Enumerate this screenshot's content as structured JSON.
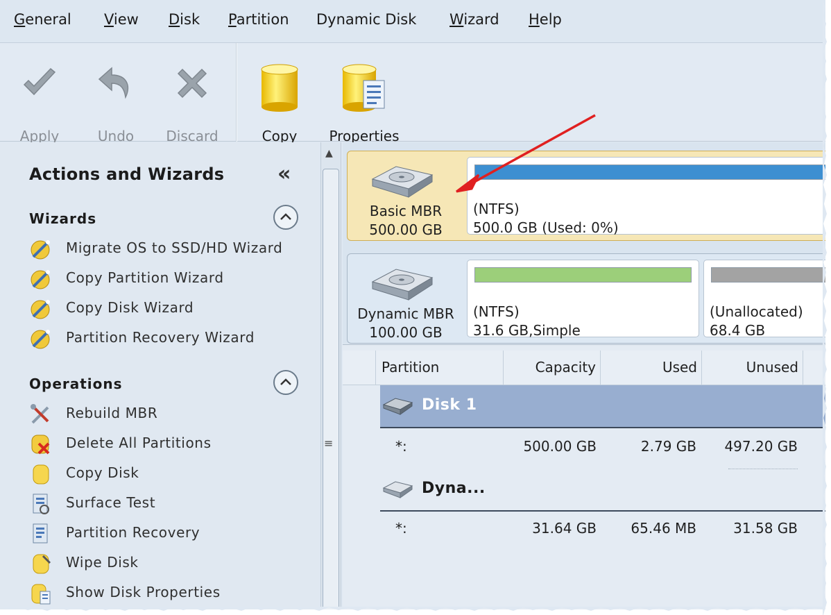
{
  "menubar": {
    "items": [
      {
        "label": "General",
        "underline": "G",
        "rest": "eneral"
      },
      {
        "label": "View",
        "underline": "V",
        "rest": "iew"
      },
      {
        "label": "Disk",
        "underline": "D",
        "rest": "isk"
      },
      {
        "label": "Partition",
        "underline": "P",
        "rest": "artition"
      },
      {
        "label": "Dynamic Disk",
        "underline": "",
        "rest": "Dynamic Disk"
      },
      {
        "label": "Wizard",
        "underline": "W",
        "rest": "izard"
      },
      {
        "label": "Help",
        "underline": "H",
        "rest": "elp"
      }
    ]
  },
  "toolbar": {
    "apply_label": "Apply",
    "undo_label": "Undo",
    "discard_label": "Discard",
    "copy_label": "Copy",
    "properties_label": "Properties"
  },
  "sidebar": {
    "title": "Actions and Wizards",
    "collapse_glyph": "«",
    "wizards": {
      "heading": "Wizards",
      "items": [
        {
          "label": "Migrate OS to SSD/HD Wizard",
          "icon": "wizard-wand-icon"
        },
        {
          "label": "Copy Partition Wizard",
          "icon": "wizard-wand-icon"
        },
        {
          "label": "Copy Disk Wizard",
          "icon": "wizard-wand-icon"
        },
        {
          "label": "Partition Recovery Wizard",
          "icon": "wizard-wand-icon"
        }
      ]
    },
    "operations": {
      "heading": "Operations",
      "items": [
        {
          "label": "Rebuild MBR",
          "icon": "tools-icon"
        },
        {
          "label": "Delete All Partitions",
          "icon": "delete-disk-icon"
        },
        {
          "label": "Copy Disk",
          "icon": "disk-copy-icon"
        },
        {
          "label": "Surface Test",
          "icon": "surface-test-icon"
        },
        {
          "label": "Partition Recovery",
          "icon": "partition-recovery-icon"
        },
        {
          "label": "Wipe Disk",
          "icon": "wipe-disk-icon"
        },
        {
          "label": "Show Disk Properties",
          "icon": "disk-properties-icon"
        }
      ]
    }
  },
  "diskmap": {
    "disks": [
      {
        "type": "Basic MBR",
        "size": "500.00 GB",
        "partitions": [
          {
            "fs": "(NTFS)",
            "detail": "500.0 GB (Used: 0%)",
            "bar_color": "#3d8fd1",
            "used_fraction": 1.0
          }
        ]
      },
      {
        "type": "Dynamic MBR",
        "size": "100.00 GB",
        "partitions": [
          {
            "fs": "(NTFS)",
            "detail": "31.6 GB,Simple",
            "bar_color": "#9ccf7a",
            "used_fraction": 1.0
          },
          {
            "fs": "(Unallocated)",
            "detail": "68.4 GB",
            "bar_color": "#a3a3a3",
            "used_fraction": 1.0
          }
        ]
      }
    ]
  },
  "table": {
    "headers": [
      "Partition",
      "Capacity",
      "Used",
      "Unused"
    ],
    "groups": [
      {
        "name": "Disk 1",
        "rows": [
          {
            "partition": "*:",
            "capacity": "500.00 GB",
            "used": "2.79 GB",
            "unused": "497.20 GB"
          }
        ]
      },
      {
        "name": "Dyna...",
        "rows": [
          {
            "partition": "*:",
            "capacity": "31.64 GB",
            "used": "65.46 MB",
            "unused": "31.58 GB"
          }
        ]
      }
    ]
  },
  "colors": {
    "selected_disk": "#f6e7b6",
    "selected_group": "#98aed0",
    "annotation_arrow": "#e02020"
  }
}
